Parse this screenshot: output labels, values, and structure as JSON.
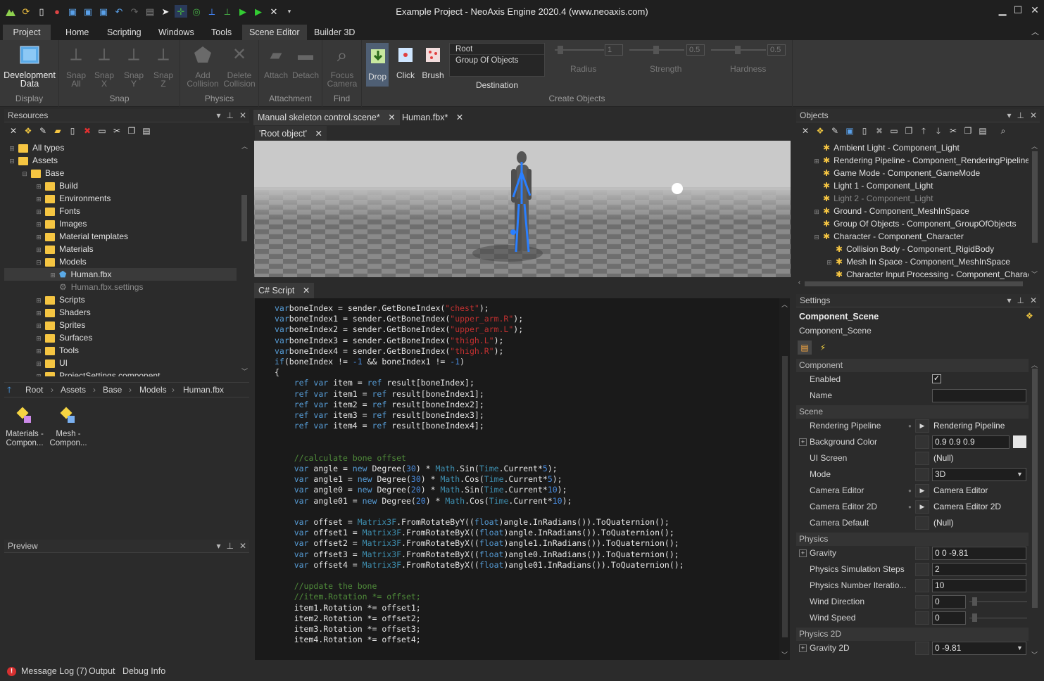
{
  "window": {
    "title": "Example Project - NeoAxis Engine 2020.4 (www.neoaxis.com)"
  },
  "menu": [
    "Project",
    "Home",
    "Scripting",
    "Windows",
    "Tools",
    "Scene Editor",
    "Builder 3D"
  ],
  "ribbon": {
    "display": {
      "label": "Display",
      "btn": "Development Data"
    },
    "snap": {
      "label": "Snap",
      "btns": [
        "Snap All",
        "Snap X",
        "Snap Y",
        "Snap Z"
      ]
    },
    "physics": {
      "label": "Physics",
      "btns": [
        "Add Collision",
        "Delete Collision"
      ]
    },
    "attachment": {
      "label": "Attachment",
      "btns": [
        "Attach",
        "Detach"
      ]
    },
    "find": {
      "label": "Find",
      "btn": "Focus Camera"
    },
    "create": {
      "label": "Create Objects",
      "btns": [
        "Drop",
        "Click",
        "Brush"
      ],
      "dest_label": "Destination",
      "dest_items": [
        "Root",
        "Group Of Objects"
      ],
      "radius_label": "Radius",
      "radius_value": "1",
      "strength_label": "Strength",
      "strength_value": "0.5",
      "hardness_label": "Hardness",
      "hardness_value": "0.5"
    }
  },
  "resources": {
    "title": "Resources",
    "tree": [
      "All types",
      "Assets",
      "Base",
      "Build",
      "Environments",
      "Fonts",
      "Images",
      "Material templates",
      "Materials",
      "Models",
      "Human.fbx",
      "Human.fbx.settings",
      "Scripts",
      "Shaders",
      "Sprites",
      "Surfaces",
      "Tools",
      "UI",
      "ProjectSettings.component"
    ],
    "breadcrumb": [
      "Root",
      "Assets",
      "Base",
      "Models",
      "Human.fbx"
    ],
    "files": [
      {
        "l1": "Materials -",
        "l2": "Compon..."
      },
      {
        "l1": "Mesh -",
        "l2": "Compon..."
      }
    ]
  },
  "preview": {
    "title": "Preview"
  },
  "tabs": {
    "doc1": "Manual skeleton control.scene*",
    "doc2": "Human.fbx*",
    "sub": "'Root object'",
    "script": "C# Script"
  },
  "objects": {
    "title": "Objects",
    "items": [
      "Ambient Light - Component_Light",
      "Rendering Pipeline - Component_RenderingPipeline_Def",
      "Game Mode - Component_GameMode",
      "Light 1 - Component_Light",
      "Light 2 - Component_Light",
      "Ground - Component_MeshInSpace",
      "Group Of Objects - Component_GroupOfObjects",
      "Character - Component_Character",
      "Collision Body - Component_RigidBody",
      "Mesh In Space - Component_MeshInSpace",
      "Character Input Processing - Component_Character"
    ]
  },
  "settings": {
    "title": "Settings",
    "header": "Component_Scene",
    "sub": "Component_Scene",
    "sections": {
      "component": "Component",
      "scene": "Scene",
      "physics": "Physics",
      "physics2d": "Physics 2D"
    },
    "rows": {
      "enabled": "Enabled",
      "name": "Name",
      "rp": "Rendering Pipeline",
      "rp_v": "Rendering Pipeline",
      "bg": "Background Color",
      "bg_v": "0.9 0.9 0.9",
      "ui": "UI Screen",
      "ui_v": "(Null)",
      "mode": "Mode",
      "mode_v": "3D",
      "ce": "Camera Editor",
      "ce_v": "Camera Editor",
      "ce2": "Camera Editor 2D",
      "ce2_v": "Camera Editor 2D",
      "cd": "Camera Default",
      "cd_v": "(Null)",
      "grav": "Gravity",
      "grav_v": "0 0 -9.81",
      "pss": "Physics Simulation Steps",
      "pss_v": "2",
      "pni": "Physics Number Iteratio...",
      "pni_v": "10",
      "wd": "Wind Direction",
      "wd_v": "0",
      "ws": "Wind Speed",
      "ws_v": "0",
      "g2": "Gravity 2D",
      "g2_v": "0 -9.81"
    }
  },
  "status": [
    "Message Log (7)",
    "Output",
    "Debug Info"
  ],
  "code": [
    [
      [
        "kw",
        "var"
      ],
      [
        "",
        "boneIndex = sender.GetBoneIndex("
      ],
      [
        "str",
        "\"chest\""
      ],
      [
        "",
        ");"
      ]
    ],
    [
      [
        "kw",
        "var"
      ],
      [
        "",
        "boneIndex1 = sender.GetBoneIndex("
      ],
      [
        "str",
        "\"upper_arm.R\""
      ],
      [
        "",
        ");"
      ]
    ],
    [
      [
        "kw",
        "var"
      ],
      [
        "",
        "boneIndex2 = sender.GetBoneIndex("
      ],
      [
        "str",
        "\"upper_arm.L\""
      ],
      [
        "",
        ");"
      ]
    ],
    [
      [
        "kw",
        "var"
      ],
      [
        "",
        "boneIndex3 = sender.GetBoneIndex("
      ],
      [
        "str",
        "\"thigh.L\""
      ],
      [
        "",
        ");"
      ]
    ],
    [
      [
        "kw",
        "var"
      ],
      [
        "",
        "boneIndex4 = sender.GetBoneIndex("
      ],
      [
        "str",
        "\"thigh.R\""
      ],
      [
        "",
        ");"
      ]
    ],
    [
      [
        "kw",
        "if"
      ],
      [
        "",
        "(boneIndex != "
      ],
      [
        "num",
        "-1"
      ],
      [
        "",
        " && boneIndex1 != "
      ],
      [
        "num",
        "-1"
      ],
      [
        "",
        ")"
      ]
    ],
    [
      [
        "",
        "{"
      ]
    ],
    [
      [
        "",
        "    "
      ],
      [
        "kw",
        "ref var"
      ],
      [
        "",
        " item = "
      ],
      [
        "kw",
        "ref"
      ],
      [
        "",
        " result[boneIndex];"
      ]
    ],
    [
      [
        "",
        "    "
      ],
      [
        "kw",
        "ref var"
      ],
      [
        "",
        " item1 = "
      ],
      [
        "kw",
        "ref"
      ],
      [
        "",
        " result[boneIndex1];"
      ]
    ],
    [
      [
        "",
        "    "
      ],
      [
        "kw",
        "ref var"
      ],
      [
        "",
        " item2 = "
      ],
      [
        "kw",
        "ref"
      ],
      [
        "",
        " result[boneIndex2];"
      ]
    ],
    [
      [
        "",
        "    "
      ],
      [
        "kw",
        "ref var"
      ],
      [
        "",
        " item3 = "
      ],
      [
        "kw",
        "ref"
      ],
      [
        "",
        " result[boneIndex3];"
      ]
    ],
    [
      [
        "",
        "    "
      ],
      [
        "kw",
        "ref var"
      ],
      [
        "",
        " item4 = "
      ],
      [
        "kw",
        "ref"
      ],
      [
        "",
        " result[boneIndex4];"
      ]
    ],
    [
      [
        "",
        ""
      ]
    ],
    [
      [
        "",
        ""
      ]
    ],
    [
      [
        "",
        "    "
      ],
      [
        "cm",
        "//calculate bone offset"
      ]
    ],
    [
      [
        "",
        "    "
      ],
      [
        "kw",
        "var"
      ],
      [
        "",
        " angle = "
      ],
      [
        "kw",
        "new"
      ],
      [
        "",
        " Degree("
      ],
      [
        "num",
        "30"
      ],
      [
        "",
        ") * "
      ],
      [
        "ty",
        "Math"
      ],
      [
        "",
        ".Sin("
      ],
      [
        "ty",
        "Time"
      ],
      [
        "",
        ".Current*"
      ],
      [
        "num",
        "5"
      ],
      [
        "",
        ");"
      ]
    ],
    [
      [
        "",
        "    "
      ],
      [
        "kw",
        "var"
      ],
      [
        "",
        " angle1 = "
      ],
      [
        "kw",
        "new"
      ],
      [
        "",
        " Degree("
      ],
      [
        "num",
        "30"
      ],
      [
        "",
        ") * "
      ],
      [
        "ty",
        "Math"
      ],
      [
        "",
        ".Cos("
      ],
      [
        "ty",
        "Time"
      ],
      [
        "",
        ".Current*"
      ],
      [
        "num",
        "5"
      ],
      [
        "",
        ");"
      ]
    ],
    [
      [
        "",
        "    "
      ],
      [
        "kw",
        "var"
      ],
      [
        "",
        " angle0 = "
      ],
      [
        "kw",
        "new"
      ],
      [
        "",
        " Degree("
      ],
      [
        "num",
        "20"
      ],
      [
        "",
        ") * "
      ],
      [
        "ty",
        "Math"
      ],
      [
        "",
        ".Sin("
      ],
      [
        "ty",
        "Time"
      ],
      [
        "",
        ".Current*"
      ],
      [
        "num",
        "10"
      ],
      [
        "",
        ");"
      ]
    ],
    [
      [
        "",
        "    "
      ],
      [
        "kw",
        "var"
      ],
      [
        "",
        " angle01 = "
      ],
      [
        "kw",
        "new"
      ],
      [
        "",
        " Degree("
      ],
      [
        "num",
        "20"
      ],
      [
        "",
        ") * "
      ],
      [
        "ty",
        "Math"
      ],
      [
        "",
        ".Cos("
      ],
      [
        "ty",
        "Time"
      ],
      [
        "",
        ".Current*"
      ],
      [
        "num",
        "10"
      ],
      [
        "",
        ");"
      ]
    ],
    [
      [
        "",
        ""
      ]
    ],
    [
      [
        "",
        "    "
      ],
      [
        "kw",
        "var"
      ],
      [
        "",
        " offset = "
      ],
      [
        "ty",
        "Matrix3F"
      ],
      [
        "",
        ".FromRotateByY(("
      ],
      [
        "kw",
        "float"
      ],
      [
        "",
        ")angle.InRadians()).ToQuaternion();"
      ]
    ],
    [
      [
        "",
        "    "
      ],
      [
        "kw",
        "var"
      ],
      [
        "",
        " offset1 = "
      ],
      [
        "ty",
        "Matrix3F"
      ],
      [
        "",
        ".FromRotateByX(("
      ],
      [
        "kw",
        "float"
      ],
      [
        "",
        ")angle.InRadians()).ToQuaternion();"
      ]
    ],
    [
      [
        "",
        "    "
      ],
      [
        "kw",
        "var"
      ],
      [
        "",
        " offset2 = "
      ],
      [
        "ty",
        "Matrix3F"
      ],
      [
        "",
        ".FromRotateByX(("
      ],
      [
        "kw",
        "float"
      ],
      [
        "",
        ")angle1.InRadians()).ToQuaternion();"
      ]
    ],
    [
      [
        "",
        "    "
      ],
      [
        "kw",
        "var"
      ],
      [
        "",
        " offset3 = "
      ],
      [
        "ty",
        "Matrix3F"
      ],
      [
        "",
        ".FromRotateByX(("
      ],
      [
        "kw",
        "float"
      ],
      [
        "",
        ")angle0.InRadians()).ToQuaternion();"
      ]
    ],
    [
      [
        "",
        "    "
      ],
      [
        "kw",
        "var"
      ],
      [
        "",
        " offset4 = "
      ],
      [
        "ty",
        "Matrix3F"
      ],
      [
        "",
        ".FromRotateByX(("
      ],
      [
        "kw",
        "float"
      ],
      [
        "",
        ")angle01.InRadians()).ToQuaternion();"
      ]
    ],
    [
      [
        "",
        ""
      ]
    ],
    [
      [
        "",
        "    "
      ],
      [
        "cm",
        "//update the bone"
      ]
    ],
    [
      [
        "",
        "    "
      ],
      [
        "cm",
        "//item.Rotation *= offset;"
      ]
    ],
    [
      [
        "",
        "    item1.Rotation *= offset1;"
      ]
    ],
    [
      [
        "",
        "    item2.Rotation *= offset2;"
      ]
    ],
    [
      [
        "",
        "    item3.Rotation *= offset3;"
      ]
    ],
    [
      [
        "",
        "    item4.Rotation *= offset4;"
      ]
    ]
  ]
}
